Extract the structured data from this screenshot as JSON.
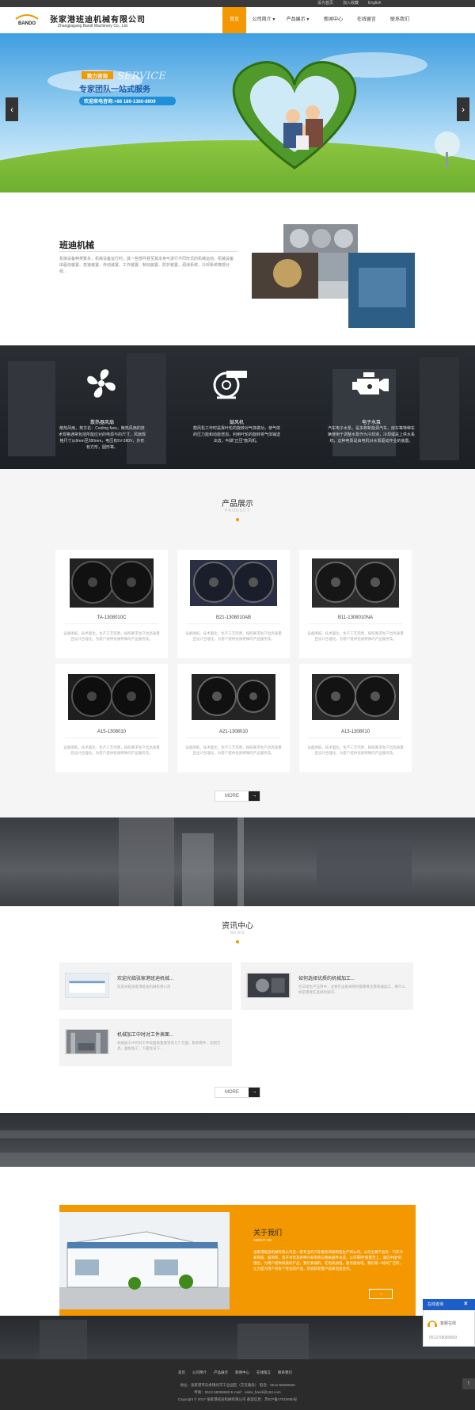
{
  "topbar": {
    "links": [
      "设为首页",
      "加入收藏",
      "English"
    ]
  },
  "header": {
    "logo_text": "BANDO",
    "company_cn": "张家港班迪机械有限公司",
    "company_en": "Zhangjiagang Bandi Machinery Co., Ltd."
  },
  "nav": {
    "items": [
      "首页",
      "公司简介",
      "产品展示",
      "新闻中心",
      "在线留言",
      "联系我们"
    ]
  },
  "banner": {
    "badge": "致力咨询",
    "service_word": "SERVICE",
    "slogan": "专家团队一站式服务",
    "hotline": "欢迎来电咨询:+86 189-1360-8909",
    "prev": "‹",
    "next": "›"
  },
  "intro": {
    "title": "班迪机械",
    "text": "机械设备种类繁多，机械设备运行时，其一些部件甚至其本身可进行不同形式的机械运动。机械设备由驱动装置、变速装置、传动装置、工作装置、制动装置、防护装置、润滑系统、冷却系统等部分组..."
  },
  "features": [
    {
      "title": "散热器风扇",
      "text": "散热风扇，英文名：Cooling fans，散热风扇的技术规格通常包括所能应对的电源与的尺寸，风扇规格尺寸从8mm至280mm，电压有5V-380V，外形有方形，圆形等。"
    },
    {
      "title": "鼓风机",
      "text": "鼓风机工作时是靠叶轮的旋转对气体做功，使气体的压力能和动能增加，利用叶轮的旋转将气体输送出去，叫做“正压”鼓风机。"
    },
    {
      "title": "电子水泵",
      "text": "汽车电子水泵，是多数新能源汽车，房车等特种车辆使用于调整水泵作为冷却液，冷却或是上供水系统，这种电泵是由电机对水泵驱动作业的装置。"
    }
  ],
  "products_section": {
    "title": "产品展示",
    "subtitle": "PRODUCT"
  },
  "products": [
    {
      "name": "TA-1308010C",
      "desc": "设备图纸，技术面化，生产工艺完善，按照要求生产出高质量且设计合理化，为客户提供优质特殊的产品服务及。"
    },
    {
      "name": "B21-1308010AB",
      "desc": "设备图纸，技术面化，生产工艺完善，按照要求生产出高质量且设计合理化，为客户提供优质特殊的产品服务及。"
    },
    {
      "name": "B11-1308010NA",
      "desc": "设备图纸，技术面化，生产工艺完善，按照要求生产出高质量且设计合理化，为客户提供优质特殊的产品服务及。"
    },
    {
      "name": "A15-1308010",
      "desc": "设备图纸，技术面化，生产工艺完善，按照要求生产出高质量且设计合理化，为客户提供优质特殊的产品服务及。"
    },
    {
      "name": "A21-1308010",
      "desc": "设备图纸，技术面化，生产工艺完善，按照要求生产出高质量且设计合理化，为客户提供优质特殊的产品服务及。"
    },
    {
      "name": "A13-1308010",
      "desc": "设备图纸，技术面化，生产工艺完善，按照要求生产出高质量且设计合理化，为客户提供优质特殊的产品服务及。"
    }
  ],
  "more_label": "MORE",
  "news_section": {
    "title": "资讯中心",
    "subtitle": "NEWS"
  },
  "news": [
    {
      "title": "欢迎光临张家港班迪机械...",
      "desc": "欢迎光临张家港班迪机械有限公司"
    },
    {
      "title": "如何选择优质的机械加工...",
      "desc": "在日常生产应用中，业者在设备采购时都需要注意机械加工，那什么样是需要在选择优质的..."
    },
    {
      "title": "机械加工中时对工件表面...",
      "desc": "机械加工中时对工件表面质量要求有几个方面，影响零件、切削刀具、磨削加工、下面会说下..."
    }
  ],
  "about": {
    "title": "关于我们",
    "subtitle": "ABOUT US",
    "text": "张家港班迪机械有限公司是一家专业的汽车散热风扇制造生产的公司。公司主要产品有：汽车冷却风扇、鼓风机、电子水泵及各种冷却系统与相关器件总成，公司秉持“质量至上，诚信中国”的理念，为用户提供高质的产品，我们真诚的，在电机加强，重点驱动电，我们第一时间广泛的，让力是为用户开发个性化的产品，欢迎新老客户前来洽谈合作。",
    "button": "→"
  },
  "footer": {
    "nav": [
      "首页",
      "公司简介",
      "产品展示",
      "新闻中心",
      "在线留言",
      "联系我们"
    ],
    "line1": "地址：张家港市乐余镇兆丰工业园区（交叉路段） 电话：0512-58089669",
    "line2": "传真：0512-58089669 E-mail：sales_bandi@163.com",
    "line3": "Copyright © 2017 张家港班迪机械有限公司 备案信息：苏ICP备17024680号"
  },
  "chat": {
    "title": "在线咨询",
    "close": "×",
    "entry": "客服在线",
    "phone": "0512-58089669"
  },
  "totop": "↑",
  "colors": {
    "accent": "#f39800",
    "dark": "#2b2b2b",
    "chat_blue": "#1d5ec9"
  }
}
